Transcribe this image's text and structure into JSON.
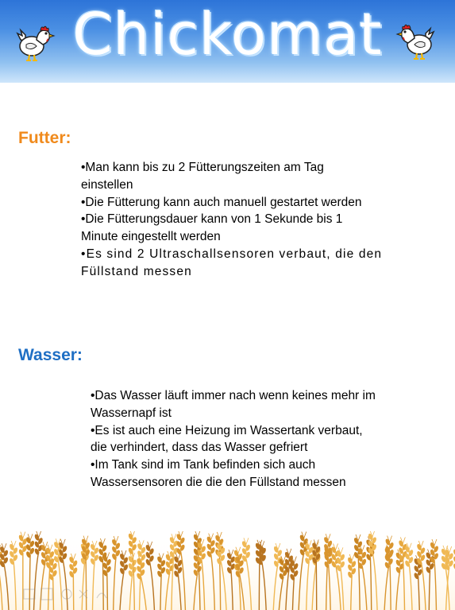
{
  "header": {
    "title": "Chickomat",
    "left_icon": "chicken-icon",
    "right_icon": "chicken-icon",
    "colors": {
      "top": "#2d74d8",
      "bottom": "#cfe6fb"
    }
  },
  "futter": {
    "heading": "Futter:",
    "color": "#f08a1c",
    "items": [
      "•Man kann bis zu 2 Fütterungszeiten am Tag\n einstellen",
      "•Die Fütterung  kann auch manuell gestartet werden",
      "•Die Fütterungsdauer kann von 1 Sekunde bis 1\n Minute eingestellt werden",
      "•Es sind 2 Ultraschallsensoren verbaut, die den\n Füllstand messen"
    ]
  },
  "wasser": {
    "heading": "Wasser:",
    "color": "#1f6fc4",
    "items": [
      "•Das Wasser läuft immer nach wenn keines mehr im\n  Wassernapf ist",
      "•Es ist auch eine Heizung im Wassertank verbaut,\n die verhindert, dass das Wasser gefriert",
      "•Im Tank sind  im Tank befinden sich  auch\n  Wassersensoren die die den Füllstand messen"
    ]
  },
  "footer": {
    "decoration": "wheat-field"
  }
}
